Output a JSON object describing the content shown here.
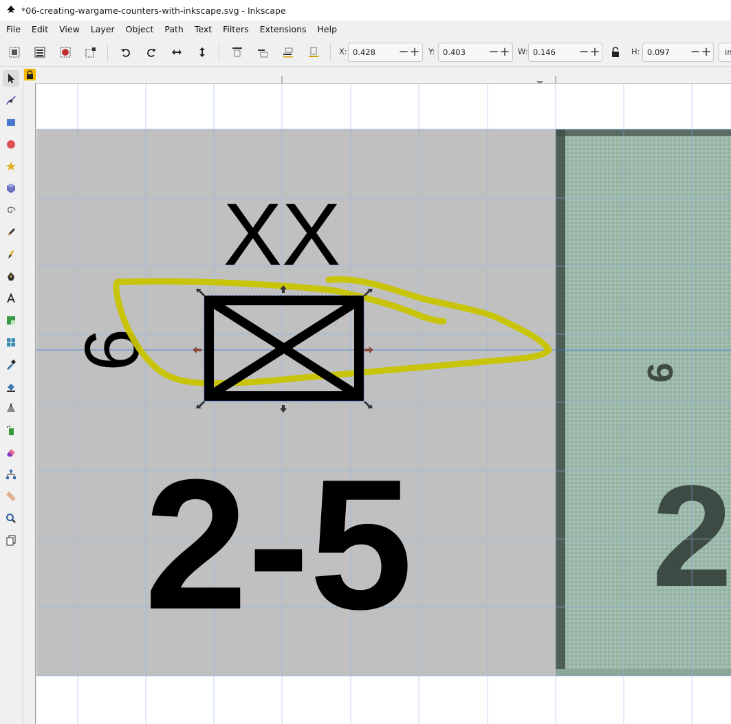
{
  "window": {
    "title": "*06-creating-wargame-counters-with-inkscape.svg - Inkscape"
  },
  "menubar": {
    "items": [
      "File",
      "Edit",
      "View",
      "Layer",
      "Object",
      "Path",
      "Text",
      "Filters",
      "Extensions",
      "Help"
    ]
  },
  "toolbar": {
    "x_label": "X:",
    "x_value": "0.428",
    "y_label": "Y:",
    "y_value": "0.403",
    "w_label": "W:",
    "w_value": "0.146",
    "h_label": "H:",
    "h_value": "0.097",
    "minus": "−",
    "plus": "+",
    "unit": "in"
  },
  "counter": {
    "size_label": "XX",
    "unit_label": "6",
    "strength": "2-5",
    "bg_color": "#c0c0c0",
    "ink_color": "#000000",
    "scribble_color": "#c8c400"
  },
  "reference_image": {
    "unit_label": "6",
    "strength_partial": "2"
  }
}
